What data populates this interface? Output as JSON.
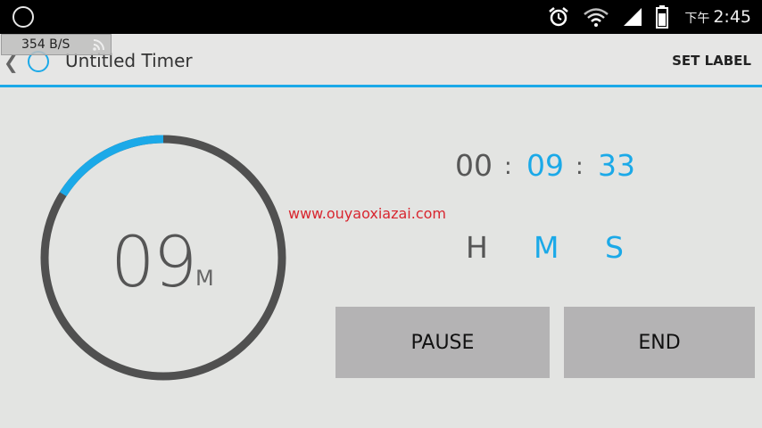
{
  "status_bar": {
    "time_period": "下午",
    "time": "2:45",
    "icons": [
      "alarm-icon",
      "wifi-icon",
      "signal-icon",
      "battery-icon"
    ]
  },
  "net_speed": "354 B/S",
  "action_bar": {
    "title": "Untitled Timer",
    "set_label": "SET LABEL"
  },
  "dial": {
    "value": "09",
    "unit": "M",
    "progress_fraction": 0.16
  },
  "watermark": "www.ouyaoxiazai.com",
  "timer": {
    "hours": "00",
    "minutes": "09",
    "seconds": "33",
    "separator": ":",
    "labels": {
      "h": "H",
      "m": "M",
      "s": "S"
    }
  },
  "buttons": {
    "pause": "PAUSE",
    "end": "END"
  },
  "colors": {
    "accent": "#1ba9e8",
    "dial_track": "#505050",
    "background": "#e3e4e2",
    "button": "#b4b3b4"
  }
}
